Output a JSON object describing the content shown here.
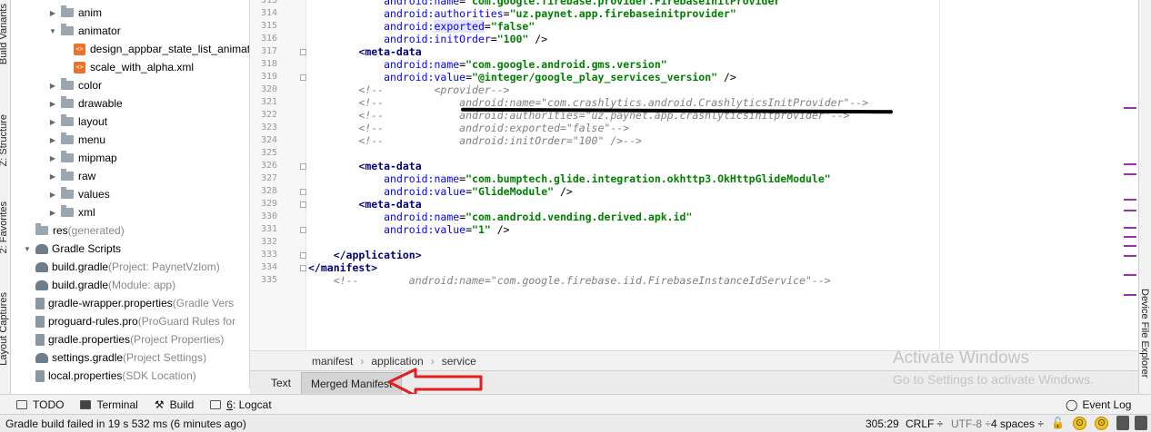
{
  "left_tool_tabs": [
    "Build Variants",
    "Z: Structure",
    "2: Favorites",
    "Layout Captures"
  ],
  "right_tool_tabs": [
    "Device File Explorer"
  ],
  "tree": [
    {
      "label": "anim",
      "type": "folder",
      "indent": 3,
      "suffix": ""
    },
    {
      "label": "animator",
      "type": "folder-open",
      "indent": 3,
      "suffix": ""
    },
    {
      "label": "design_appbar_state_list_animat",
      "type": "xml",
      "indent": 5,
      "suffix": ""
    },
    {
      "label": "scale_with_alpha.xml",
      "type": "xml",
      "indent": 5,
      "suffix": ""
    },
    {
      "label": "color",
      "type": "folder",
      "indent": 3,
      "suffix": ""
    },
    {
      "label": "drawable",
      "type": "folder",
      "indent": 3,
      "suffix": ""
    },
    {
      "label": "layout",
      "type": "folder",
      "indent": 3,
      "suffix": ""
    },
    {
      "label": "menu",
      "type": "folder",
      "indent": 3,
      "suffix": ""
    },
    {
      "label": "mipmap",
      "type": "folder",
      "indent": 3,
      "suffix": ""
    },
    {
      "label": "raw",
      "type": "folder",
      "indent": 3,
      "suffix": ""
    },
    {
      "label": "values",
      "type": "folder",
      "indent": 3,
      "suffix": ""
    },
    {
      "label": "xml",
      "type": "folder",
      "indent": 3,
      "suffix": ""
    },
    {
      "label": "res",
      "type": "folder-plain",
      "indent": 2,
      "suffix": " (generated)"
    },
    {
      "label": "Gradle Scripts",
      "type": "gradle-root",
      "indent": 1,
      "suffix": ""
    },
    {
      "label": "build.gradle",
      "type": "gradle",
      "indent": 2,
      "suffix": " (Project: PaynetVzlom)"
    },
    {
      "label": "build.gradle",
      "type": "gradle",
      "indent": 2,
      "suffix": " (Module: app)"
    },
    {
      "label": "gradle-wrapper.properties",
      "type": "file",
      "indent": 2,
      "suffix": " (Gradle Vers"
    },
    {
      "label": "proguard-rules.pro",
      "type": "file",
      "indent": 2,
      "suffix": " (ProGuard Rules for"
    },
    {
      "label": "gradle.properties",
      "type": "file",
      "indent": 2,
      "suffix": " (Project Properties)"
    },
    {
      "label": "settings.gradle",
      "type": "gradle",
      "indent": 2,
      "suffix": " (Project Settings)"
    },
    {
      "label": "local.properties",
      "type": "file",
      "indent": 2,
      "suffix": " (SDK Location)"
    }
  ],
  "code_lines": [
    {
      "n": "313",
      "html": "            <span class='attr'>android:name</span>=<span class='val'>\"com.google.firebase.provider.FirebaseInitProvider\"</span>"
    },
    {
      "n": "314",
      "html": "            <span class='attr'>android:authorities</span>=<span class='val'>\"uz.paynet.app.firebaseinitprovider\"</span>"
    },
    {
      "n": "315",
      "html": "            <span class='attr'>android:<span class='hl'>exported</span></span>=<span class='val'>\"false\"</span>"
    },
    {
      "n": "316",
      "html": "            <span class='attr'>android:initOrder</span>=<span class='val'>\"100\"</span> /&gt;"
    },
    {
      "n": "317",
      "html": "        <span class='tag'>&lt;meta-data</span>"
    },
    {
      "n": "318",
      "html": "            <span class='attr'>android:name</span>=<span class='val'>\"com.google.android.gms.version\"</span>"
    },
    {
      "n": "319",
      "html": "            <span class='attr'>android:value</span>=<span class='val'>\"@integer/google_play_services_version\"</span> /&gt;"
    },
    {
      "n": "320",
      "html": "<span class='comment'>        &lt;!--        &lt;provider--&gt;</span>"
    },
    {
      "n": "321",
      "html": "<span class='comment'>        &lt;!--            android:name=\"com.crashlytics.android.CrashlyticsInitProvider\"--&gt;</span>"
    },
    {
      "n": "322",
      "html": "<span class='comment'>        &lt;!--            android:authorities=\"uz.paynet.app.crashlyticsinitprovider\"--&gt;</span>"
    },
    {
      "n": "323",
      "html": "<span class='comment'>        &lt;!--            android:exported=\"false\"--&gt;</span>"
    },
    {
      "n": "324",
      "html": "<span class='comment'>        &lt;!--            android:initOrder=\"100\" /&gt;--&gt;</span>"
    },
    {
      "n": "325",
      "html": ""
    },
    {
      "n": "326",
      "html": "        <span class='tag'>&lt;meta-data</span>"
    },
    {
      "n": "327",
      "html": "            <span class='attr'>android:name</span>=<span class='val'>\"com.bumptech.glide.integration.okhttp3.OkHttpGlideModule\"</span>"
    },
    {
      "n": "328",
      "html": "            <span class='attr'>android:value</span>=<span class='val'>\"GlideModule\"</span> /&gt;"
    },
    {
      "n": "329",
      "html": "        <span class='tag'>&lt;meta-data</span>"
    },
    {
      "n": "330",
      "html": "            <span class='attr'>android:name</span>=<span class='val'>\"com.android.vending.derived.apk.id\"</span>"
    },
    {
      "n": "331",
      "html": "            <span class='attr'>android:value</span>=<span class='val'>\"1\"</span> /&gt;"
    },
    {
      "n": "332",
      "html": ""
    },
    {
      "n": "333",
      "html": "    <span class='tag'>&lt;/application&gt;</span>"
    },
    {
      "n": "334",
      "html": "<span class='tag'>&lt;/manifest&gt;</span>"
    },
    {
      "n": "335",
      "html": "<span class='comment'>    &lt;!--        android:name=\"com.google.firebase.iid.FirebaseInstanceIdService\"--&gt;</span>"
    }
  ],
  "breadcrumb": [
    "manifest",
    "application",
    "service"
  ],
  "editor_tabs": {
    "text": "Text",
    "merged": "Merged Manifest"
  },
  "watermark": {
    "title": "Activate Windows",
    "subtitle": "Go to Settings to activate Windows."
  },
  "tool_windows": {
    "todo": "TODO",
    "terminal": "Terminal",
    "build": "Build",
    "logcat_num": "6",
    "logcat": ": Logcat",
    "event_log": "Event Log"
  },
  "status": {
    "message": "Gradle build failed in 19 s 532 ms (6 minutes ago)",
    "position": "305:29",
    "line_sep": "CRLF ÷",
    "encoding": "UTF-8 ÷",
    "indent": "4 spaces ÷"
  },
  "colors": {
    "accent_red": "#e02020",
    "marker_purple": "#9b2fae"
  }
}
